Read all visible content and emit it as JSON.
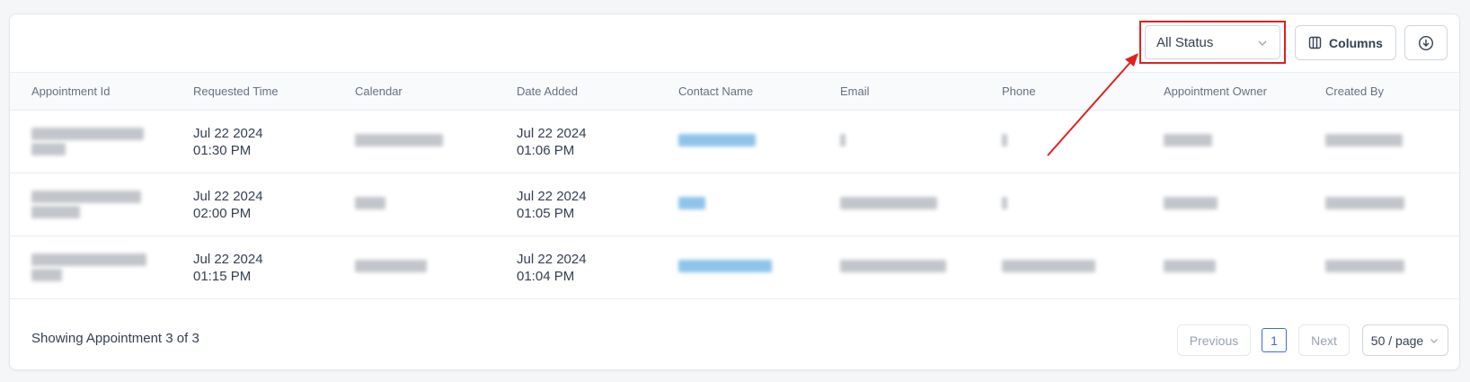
{
  "toolbar": {
    "status_filter": "All Status",
    "columns_label": "Columns"
  },
  "table": {
    "headers": [
      "Appointment Id",
      "Requested Time",
      "Calendar",
      "Date Added",
      "Contact Name",
      "Email",
      "Phone",
      "Appointment Owner",
      "Created By"
    ],
    "rows": [
      {
        "requested_date": "Jul 22 2024",
        "requested_time": "01:30 PM",
        "added_date": "Jul 22 2024",
        "added_time": "01:06 PM"
      },
      {
        "requested_date": "Jul 22 2024",
        "requested_time": "02:00 PM",
        "added_date": "Jul 22 2024",
        "added_time": "01:05 PM"
      },
      {
        "requested_date": "Jul 22 2024",
        "requested_time": "01:15 PM",
        "added_date": "Jul 22 2024",
        "added_time": "01:04 PM"
      }
    ]
  },
  "footer": {
    "showing": "Showing Appointment 3 of 3",
    "previous": "Previous",
    "page": "1",
    "next": "Next",
    "per_page": "50 / page"
  },
  "colors": {
    "accent": "#4169e1",
    "highlight": "#e02020",
    "link": "#8fc4ea"
  },
  "icons": [
    "chevron-down-icon",
    "columns-icon",
    "download-icon",
    "annotation-arrow"
  ]
}
